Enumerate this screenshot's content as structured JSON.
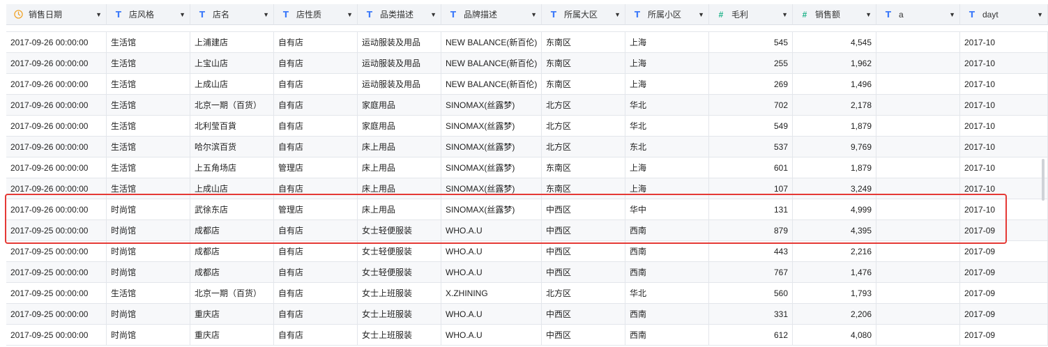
{
  "columns": [
    {
      "label": "销售日期",
      "type": "date"
    },
    {
      "label": "店风格",
      "type": "text"
    },
    {
      "label": "店名",
      "type": "text"
    },
    {
      "label": "店性质",
      "type": "text"
    },
    {
      "label": "品类描述",
      "type": "text"
    },
    {
      "label": "品牌描述",
      "type": "text"
    },
    {
      "label": "所属大区",
      "type": "text"
    },
    {
      "label": "所属小区",
      "type": "text"
    },
    {
      "label": "毛利",
      "type": "number"
    },
    {
      "label": "销售额",
      "type": "number"
    },
    {
      "label": "a",
      "type": "text"
    },
    {
      "label": "dayt",
      "type": "text"
    }
  ],
  "icons": {
    "text": "T",
    "number": "#",
    "date": "clock-icon",
    "caret": "▼"
  },
  "colors": {
    "highlight": "#e53935",
    "text_icon": "#3e7bfa",
    "number_icon": "#21b38a",
    "date_icon": "#f0a020"
  },
  "rows": [
    [
      "2017-09-26 00:00:00",
      "生活馆",
      "上浦建店",
      "自有店",
      "运动服装及用品",
      "NEW BALANCE(新百伦)",
      "东南区",
      "上海",
      "545",
      "4,545",
      "",
      "2017-10"
    ],
    [
      "2017-09-26 00:00:00",
      "生活馆",
      "上宝山店",
      "自有店",
      "运动服装及用品",
      "NEW BALANCE(新百伦)",
      "东南区",
      "上海",
      "255",
      "1,962",
      "",
      "2017-10"
    ],
    [
      "2017-09-26 00:00:00",
      "生活馆",
      "上成山店",
      "自有店",
      "运动服装及用品",
      "NEW BALANCE(新百伦)",
      "东南区",
      "上海",
      "269",
      "1,496",
      "",
      "2017-10"
    ],
    [
      "2017-09-26 00:00:00",
      "生活馆",
      "北京一期（百货）",
      "自有店",
      "家庭用品",
      "SINOMAX(丝露梦)",
      "北方区",
      "华北",
      "702",
      "2,178",
      "",
      "2017-10"
    ],
    [
      "2017-09-26 00:00:00",
      "生活馆",
      "北利莹百貨",
      "自有店",
      "家庭用品",
      "SINOMAX(丝露梦)",
      "北方区",
      "华北",
      "549",
      "1,879",
      "",
      "2017-10"
    ],
    [
      "2017-09-26 00:00:00",
      "生活馆",
      "哈尔滨百货",
      "自有店",
      "床上用品",
      "SINOMAX(丝露梦)",
      "北方区",
      "东北",
      "537",
      "9,769",
      "",
      "2017-10"
    ],
    [
      "2017-09-26 00:00:00",
      "生活馆",
      "上五角场店",
      "管理店",
      "床上用品",
      "SINOMAX(丝露梦)",
      "东南区",
      "上海",
      "601",
      "1,879",
      "",
      "2017-10"
    ],
    [
      "2017-09-26 00:00:00",
      "生活馆",
      "上成山店",
      "自有店",
      "床上用品",
      "SINOMAX(丝露梦)",
      "东南区",
      "上海",
      "107",
      "3,249",
      "",
      "2017-10"
    ],
    [
      "2017-09-26 00:00:00",
      "时尚馆",
      "武徐东店",
      "管理店",
      "床上用品",
      "SINOMAX(丝露梦)",
      "中西区",
      "华中",
      "131",
      "4,999",
      "",
      "2017-10"
    ],
    [
      "2017-09-25 00:00:00",
      "时尚馆",
      "成都店",
      "自有店",
      "女士轻便服装",
      "WHO.A.U",
      "中西区",
      "西南",
      "879",
      "4,395",
      "",
      "2017-09"
    ],
    [
      "2017-09-25 00:00:00",
      "时尚馆",
      "成都店",
      "自有店",
      "女士轻便服装",
      "WHO.A.U",
      "中西区",
      "西南",
      "443",
      "2,216",
      "",
      "2017-09"
    ],
    [
      "2017-09-25 00:00:00",
      "时尚馆",
      "成都店",
      "自有店",
      "女士轻便服装",
      "WHO.A.U",
      "中西区",
      "西南",
      "767",
      "1,476",
      "",
      "2017-09"
    ],
    [
      "2017-09-25 00:00:00",
      "生活馆",
      "北京一期（百货）",
      "自有店",
      "女士上班服装",
      "X.ZHINING",
      "北方区",
      "华北",
      "560",
      "1,793",
      "",
      "2017-09"
    ],
    [
      "2017-09-25 00:00:00",
      "时尚馆",
      "重庆店",
      "自有店",
      "女士上班服装",
      "WHO.A.U",
      "中西区",
      "西南",
      "331",
      "2,206",
      "",
      "2017-09"
    ],
    [
      "2017-09-25 00:00:00",
      "时尚馆",
      "重庆店",
      "自有店",
      "女士上班服装",
      "WHO.A.U",
      "中西区",
      "西南",
      "612",
      "4,080",
      "",
      "2017-09"
    ]
  ]
}
